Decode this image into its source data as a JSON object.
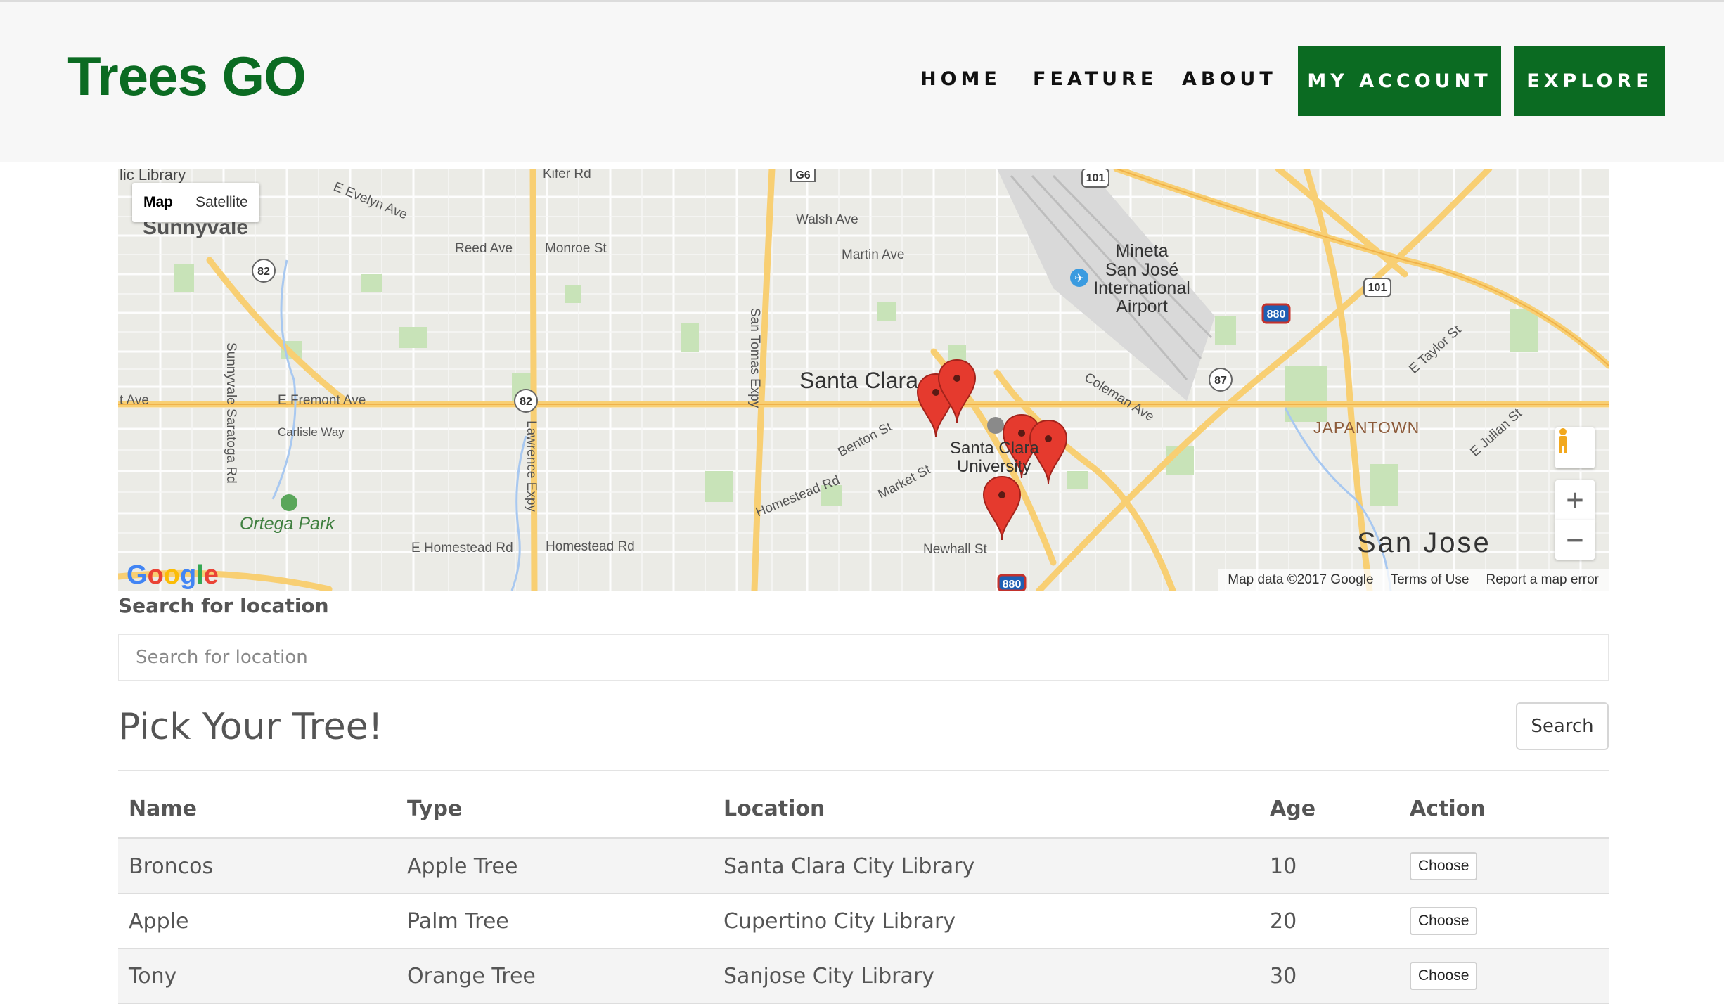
{
  "header": {
    "brand": "Trees GO",
    "nav": [
      {
        "label": "HOME"
      },
      {
        "label": "FEATURE"
      },
      {
        "label": "ABOUT"
      }
    ],
    "buttons": [
      {
        "label": "MY ACCOUNT"
      },
      {
        "label": "EXPLORE"
      }
    ],
    "brand_color": "#0b6b22"
  },
  "map": {
    "view_toggle": {
      "map": "Map",
      "satellite": "Satellite"
    },
    "labels": {
      "library": "lic Library",
      "sunnyvale": "Sunnyvale",
      "santa_clara": "Santa Clara",
      "santa_clara_university_1": "Santa Clara",
      "santa_clara_university_2": "University",
      "san_jose": "San Jose",
      "japantown": "JAPANTOWN",
      "ortega_park": "Ortega Park",
      "airport_1": "Mineta",
      "airport_2": "San José",
      "airport_3": "International",
      "airport_4": "Airport",
      "kifer": "Kifer Rd",
      "walsh": "Walsh Ave",
      "martin": "Martin Ave",
      "reed": "Reed Ave",
      "monroe": "Monroe St",
      "e_fremont": "E Fremont Ave",
      "carlisle": "Carlisle Way",
      "e_homestead": "E Homestead Rd",
      "homestead": "Homestead Rd",
      "homestead2": "Homestead Rd",
      "benton": "Benton St",
      "market": "Market St",
      "newhall": "Newhall St",
      "coleman": "Coleman Ave",
      "e_taylor": "E Taylor St",
      "e_julian": "E Julian St",
      "lawrence": "Lawrence Expy",
      "san_tomas": "San Tomas Expy",
      "t_ave": "t Ave",
      "e_evelyn": "E Evelyn Ave",
      "sunnyvale_saratoga": "Sunnyvale Saratoga Rd"
    },
    "shields": [
      "101",
      "101",
      "880",
      "880",
      "87",
      "82",
      "82",
      "G6"
    ],
    "footer": {
      "data": "Map data ©2017 Google",
      "terms": "Terms of Use",
      "report": "Report a map error"
    },
    "google_logo": "Google",
    "zoom_in": "+",
    "zoom_out": "−"
  },
  "search": {
    "label": "Search for location",
    "placeholder": "Search for location",
    "button": "Search"
  },
  "picker": {
    "title": "Pick Your Tree!"
  },
  "table": {
    "headers": {
      "name": "Name",
      "type": "Type",
      "location": "Location",
      "age": "Age",
      "action": "Action"
    },
    "rows": [
      {
        "name": "Broncos",
        "type": "Apple Tree",
        "location": "Santa Clara City Library",
        "age": "10",
        "action": "Choose"
      },
      {
        "name": "Apple",
        "type": "Palm Tree",
        "location": "Cupertino City Library",
        "age": "20",
        "action": "Choose"
      },
      {
        "name": "Tony",
        "type": "Orange Tree",
        "location": "Sanjose City Library",
        "age": "30",
        "action": "Choose"
      }
    ]
  }
}
